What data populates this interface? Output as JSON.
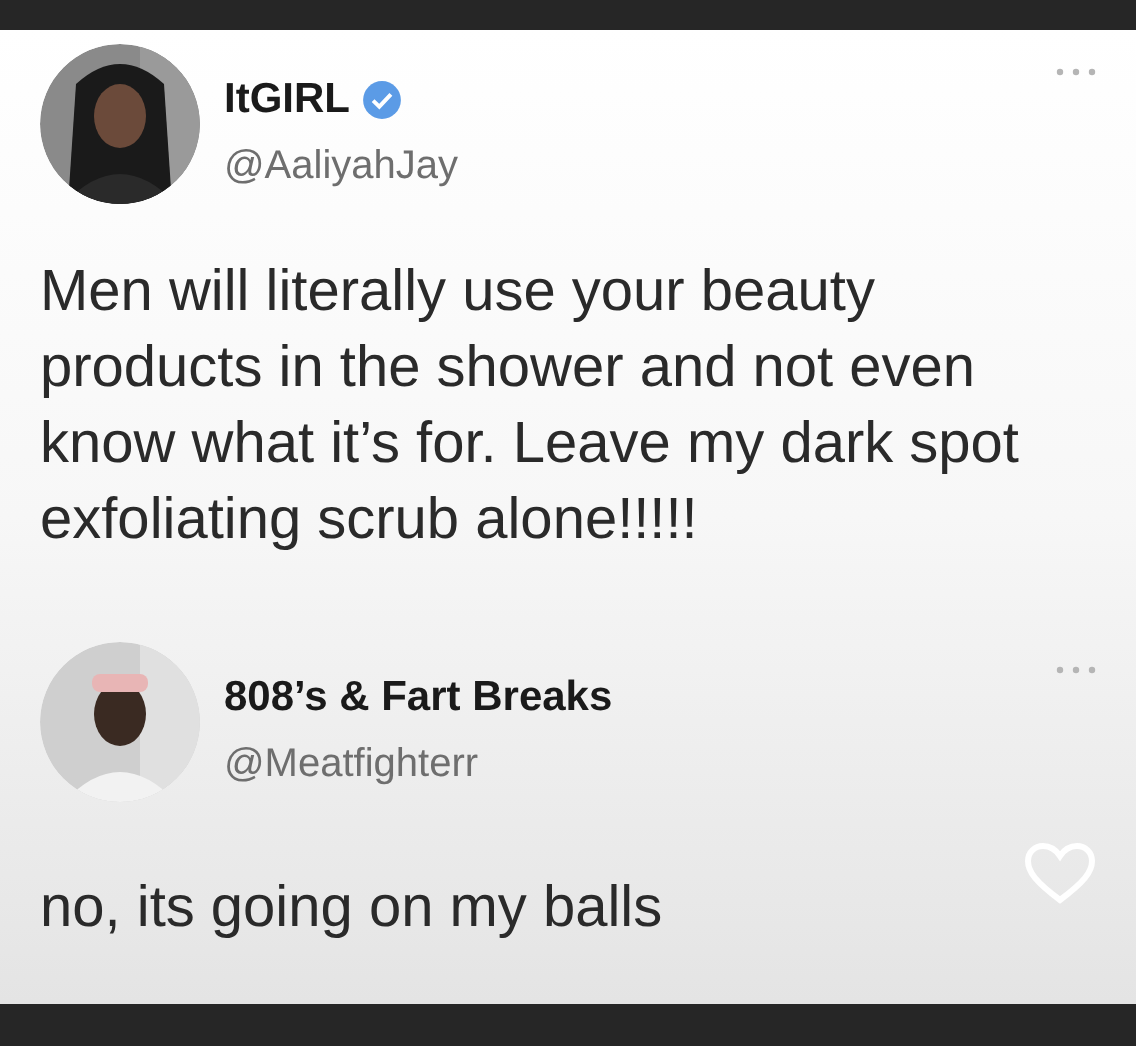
{
  "tweets": [
    {
      "name": "ItGIRL",
      "verified": true,
      "handle": "@AaliyahJay",
      "text": "Men will literally use your beauty products in the shower and not even know what it’s for. Leave my dark spot exfoliating scrub alone!!!!!"
    },
    {
      "name": "808’s & Fart Breaks",
      "verified": false,
      "handle": "@Meatfighterr",
      "text": "no, its going on my balls"
    }
  ]
}
